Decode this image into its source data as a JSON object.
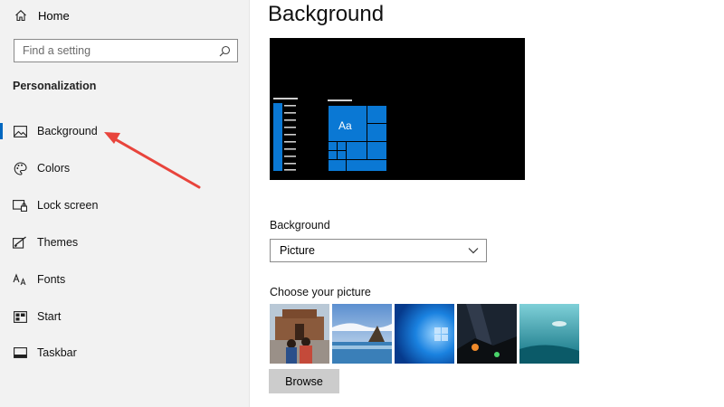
{
  "sidebar": {
    "home_label": "Home",
    "search_placeholder": "Find a setting",
    "section_title": "Personalization",
    "items": [
      {
        "label": "Background",
        "icon": "image-icon",
        "active": true
      },
      {
        "label": "Colors",
        "icon": "palette-icon"
      },
      {
        "label": "Lock screen",
        "icon": "lock-screen-icon"
      },
      {
        "label": "Themes",
        "icon": "brush-icon"
      },
      {
        "label": "Fonts",
        "icon": "font-icon"
      },
      {
        "label": "Start",
        "icon": "start-icon"
      },
      {
        "label": "Taskbar",
        "icon": "taskbar-icon"
      }
    ]
  },
  "main": {
    "title": "Background",
    "preview": {
      "tile_text": "Aa"
    },
    "background_label": "Background",
    "background_value": "Picture",
    "choose_label": "Choose your picture",
    "pictures": [
      "photo-1",
      "photo-2",
      "photo-3",
      "photo-4",
      "photo-5"
    ],
    "browse_label": "Browse"
  },
  "colors": {
    "accent": "#0078d7",
    "annotation_arrow": "#e8443c",
    "sidebar_bg": "#f2f2f2"
  }
}
